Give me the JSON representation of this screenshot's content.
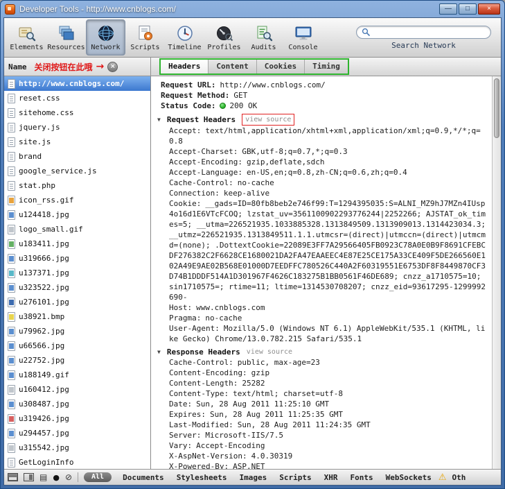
{
  "window": {
    "title": "Developer Tools - http://www.cnblogs.com/"
  },
  "icons": {
    "minimize": "—",
    "maximize": "□",
    "close": "×",
    "sidebar_close": "×",
    "collapse": "▼",
    "annotation_arrow": "→",
    "record": "●",
    "clear": "⊘",
    "rows": "▤",
    "warning": "⚠"
  },
  "colors": {
    "annotation_red": "#e01818",
    "tabs_highlight_green": "#2db32d",
    "selected_row_blue": "#3c78cf",
    "status_ok_green": "#2eb82e",
    "warning_yellow": "#e8a70c"
  },
  "toolbar": {
    "buttons": [
      {
        "label": "Elements",
        "icon": "elements-icon",
        "active": false
      },
      {
        "label": "Resources",
        "icon": "resources-icon",
        "active": false
      },
      {
        "label": "Network",
        "icon": "network-icon",
        "active": true
      },
      {
        "label": "Scripts",
        "icon": "scripts-icon",
        "active": false
      },
      {
        "label": "Timeline",
        "icon": "timeline-icon",
        "active": false
      },
      {
        "label": "Profiles",
        "icon": "profiles-icon",
        "active": false
      },
      {
        "label": "Audits",
        "icon": "audits-icon",
        "active": false
      },
      {
        "label": "Console",
        "icon": "console-icon",
        "active": false
      }
    ],
    "search_value": "",
    "search_label": "Search Network"
  },
  "sidebar": {
    "header": "Name",
    "annotation": "关闭按钮在此哦",
    "items": [
      {
        "label": "http://www.cnblogs.com/",
        "icon": "doc",
        "selected": true
      },
      {
        "label": "reset.css",
        "icon": "doc"
      },
      {
        "label": "sitehome.css",
        "icon": "doc"
      },
      {
        "label": "jquery.js",
        "icon": "doc"
      },
      {
        "label": "site.js",
        "icon": "doc"
      },
      {
        "label": "brand",
        "icon": "doc"
      },
      {
        "label": "google_service.js",
        "icon": "doc"
      },
      {
        "label": "stat.php",
        "icon": "doc"
      },
      {
        "label": "icon_rss.gif",
        "icon": "f-orange"
      },
      {
        "label": "u124418.jpg",
        "icon": "f-blue"
      },
      {
        "label": "logo_small.gif",
        "icon": "f-gray"
      },
      {
        "label": "u183411.jpg",
        "icon": "f-green"
      },
      {
        "label": "u319666.jpg",
        "icon": "f-blue"
      },
      {
        "label": "u137371.jpg",
        "icon": "f-cyan"
      },
      {
        "label": "u323522.jpg",
        "icon": "f-blue"
      },
      {
        "label": "u276101.jpg",
        "icon": "f-navy"
      },
      {
        "label": "u38921.bmp",
        "icon": "f-yellow"
      },
      {
        "label": "u79962.jpg",
        "icon": "f-blue"
      },
      {
        "label": "u66566.jpg",
        "icon": "f-blue"
      },
      {
        "label": "u22752.jpg",
        "icon": "f-blue"
      },
      {
        "label": "u188149.gif",
        "icon": "f-blue"
      },
      {
        "label": "u160412.jpg",
        "icon": "f-gray"
      },
      {
        "label": "u308487.jpg",
        "icon": "f-blue"
      },
      {
        "label": "u319426.jpg",
        "icon": "f-red"
      },
      {
        "label": "u294457.jpg",
        "icon": "f-blue"
      },
      {
        "label": "u315542.jpg",
        "icon": "f-gray"
      },
      {
        "label": "GetLoginInfo",
        "icon": "doc"
      }
    ]
  },
  "tabs": {
    "items": [
      "Headers",
      "Content",
      "Cookies",
      "Timing"
    ],
    "active": "Headers"
  },
  "panel": {
    "summary": [
      {
        "name": "Request URL:",
        "value": "http://www.cnblogs.com/"
      },
      {
        "name": "Request Method:",
        "value": "GET"
      },
      {
        "name": "Status Code:",
        "value": "200 OK",
        "dot": true
      }
    ],
    "request_headers": {
      "title": "Request Headers",
      "view_source_label": "view source",
      "headers": [
        {
          "name": "Accept:",
          "value": "text/html,application/xhtml+xml,application/xml;q=0.9,*/*;q=0.8"
        },
        {
          "name": "Accept-Charset:",
          "value": "GBK,utf-8;q=0.7,*;q=0.3"
        },
        {
          "name": "Accept-Encoding:",
          "value": "gzip,deflate,sdch"
        },
        {
          "name": "Accept-Language:",
          "value": "en-US,en;q=0.8,zh-CN;q=0.6,zh;q=0.4"
        },
        {
          "name": "Cache-Control:",
          "value": "no-cache"
        },
        {
          "name": "Connection:",
          "value": "keep-alive"
        },
        {
          "name": "Cookie:",
          "value": "__gads=ID=80fb8beb2e746f99:T=1294395035:S=ALNI_MZ9hJ7MZn4IUsp4o16d1E6VTcFCOQ; lzstat_uv=3561100902293776244|2252266; AJSTAT_ok_times=5; __utma=226521935.1033885328.1313849509.1313909013.1314423034.3; __utmz=226521935.1313849511.1.1.utmcsr=(direct)|utmccn=(direct)|utmcmd=(none); .DottextCookie=22089E3FF7A29566405FB0923C78A0E0B9F8691CFEBCDF276382C2F6628CE1680021DA2FA47EAAEEC4E87E25CE175A33CE409F5DE266560E102A49E9AE02B568E01000D7EEDFFC780526C440A2F60319551E6753DF8F8449870CF3D74B1DDDF514A1D301967F4626C183275B1BB0561F46DE689; cnzz_a1710575=10; sin1710575=; rtime=11; ltime=1314530708207; cnzz_eid=93617295-1299992690-"
        },
        {
          "name": "Host:",
          "value": "www.cnblogs.com"
        },
        {
          "name": "Pragma:",
          "value": "no-cache"
        },
        {
          "name": "User-Agent:",
          "value": "Mozilla/5.0 (Windows NT 6.1) AppleWebKit/535.1 (KHTML, like Gecko) Chrome/13.0.782.215 Safari/535.1"
        }
      ]
    },
    "response_headers": {
      "title": "Response Headers",
      "view_source_label": "view source",
      "headers": [
        {
          "name": "Cache-Control:",
          "value": "public, max-age=23"
        },
        {
          "name": "Content-Encoding:",
          "value": "gzip"
        },
        {
          "name": "Content-Length:",
          "value": "25282"
        },
        {
          "name": "Content-Type:",
          "value": "text/html; charset=utf-8"
        },
        {
          "name": "Date:",
          "value": "Sun, 28 Aug 2011 11:25:10 GMT"
        },
        {
          "name": "Expires:",
          "value": "Sun, 28 Aug 2011 11:25:35 GMT"
        },
        {
          "name": "Last-Modified:",
          "value": "Sun, 28 Aug 2011 11:24:35 GMT"
        },
        {
          "name": "Server:",
          "value": "Microsoft-IIS/7.5"
        },
        {
          "name": "Vary:",
          "value": "Accept-Encoding"
        },
        {
          "name": "X-AspNet-Version:",
          "value": "4.0.30319"
        },
        {
          "name": "X-Powered-By:",
          "value": "ASP.NET"
        }
      ]
    }
  },
  "statusbar": {
    "all_label": "All",
    "filters": [
      "Documents",
      "Stylesheets",
      "Images",
      "Scripts",
      "XHR",
      "Fonts",
      "WebSockets"
    ],
    "clipped_label": "Oth"
  }
}
